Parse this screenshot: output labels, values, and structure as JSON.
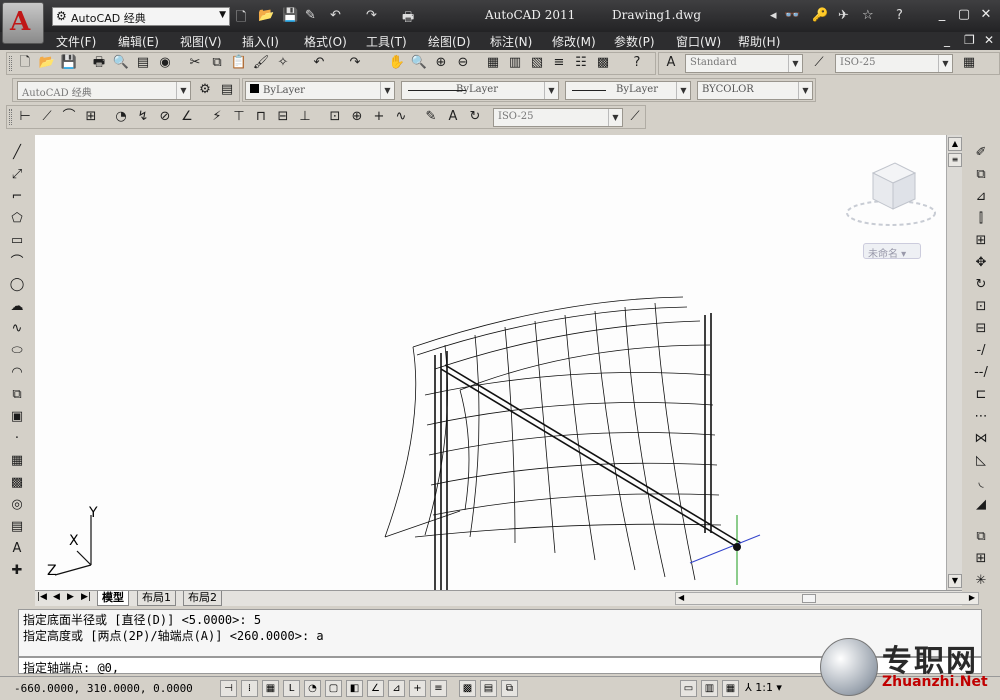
{
  "titlebar": {
    "app_logo": "A",
    "workspace": "AutoCAD 经典",
    "app_title": "AutoCAD 2011",
    "doc_title": "Drawing1.dwg"
  },
  "menu": [
    {
      "label": "文件(F)"
    },
    {
      "label": "编辑(E)"
    },
    {
      "label": "视图(V)"
    },
    {
      "label": "插入(I)"
    },
    {
      "label": "格式(O)"
    },
    {
      "label": "工具(T)"
    },
    {
      "label": "绘图(D)"
    },
    {
      "label": "标注(N)"
    },
    {
      "label": "修改(M)"
    },
    {
      "label": "参数(P)"
    },
    {
      "label": "窗口(W)"
    },
    {
      "label": "帮助(H)"
    }
  ],
  "styles": {
    "text_style": "Standard",
    "dim_style": "ISO-25",
    "dim_style2": "ISO-25"
  },
  "properties": {
    "workspace2": "AutoCAD 经典",
    "layer": "ByLayer",
    "linetype": "ByLayer",
    "lineweight": "ByLayer",
    "color": "BYCOLOR"
  },
  "viewcube": {
    "name": "未命名"
  },
  "ucs": {
    "x": "X",
    "y": "Y",
    "z": "Z"
  },
  "tabs": [
    {
      "label": "模型",
      "active": true
    },
    {
      "label": "布局1"
    },
    {
      "label": "布局2"
    }
  ],
  "command": {
    "history": [
      "指定底面半径或 [直径(D)] <5.0000>: 5",
      "指定高度或 [两点(2P)/轴端点(A)] <260.0000>: a"
    ],
    "current": "指定轴端点: @0,"
  },
  "status": {
    "coords": "-660.0000, 310.0000, 0.0000",
    "scale": "1:1"
  },
  "watermark": {
    "cn": "专职网",
    "en": "Zhuanzhi.Net"
  },
  "colors": {
    "title_bg": "#2d2d2f",
    "logo_red": "#c01818",
    "canvas_bg": "#fdfdfd"
  }
}
